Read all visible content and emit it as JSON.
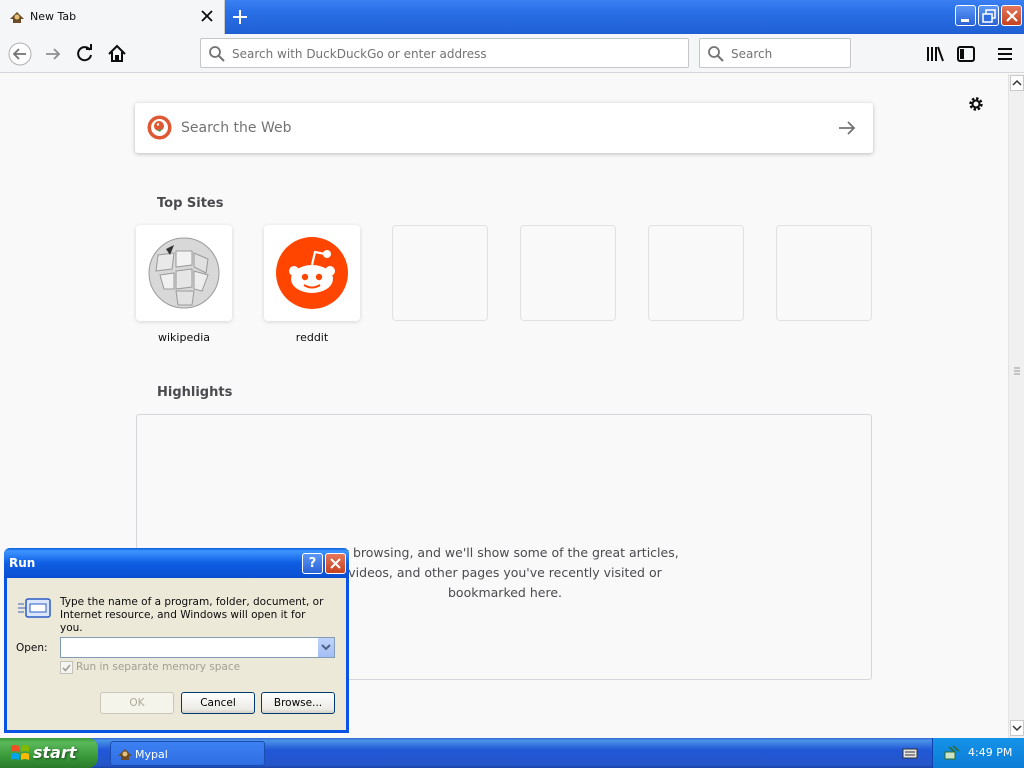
{
  "tab": {
    "title": "New Tab"
  },
  "nav": {
    "url_placeholder": "Search with DuckDuckGo or enter address",
    "search_placeholder": "Search"
  },
  "newtab": {
    "websearch_placeholder": "Search the Web",
    "top_sites_title": "Top Sites",
    "top_sites": [
      {
        "label": "wikipedia"
      },
      {
        "label": "reddit"
      },
      {
        "label": ""
      },
      {
        "label": ""
      },
      {
        "label": ""
      },
      {
        "label": ""
      }
    ],
    "highlights_title": "Highlights",
    "highlights_message_lines": [
      "art browsing, and we'll show some of the great articles,",
      "videos, and other pages you've recently visited or",
      "bookmarked here."
    ]
  },
  "run_dialog": {
    "title": "Run",
    "help_glyph": "?",
    "description": "Type the name of a program, folder, document, or Internet resource, and Windows will open it for you.",
    "open_label": "Open:",
    "open_value": "",
    "checkbox_label": "Run in separate memory space",
    "ok_label": "OK",
    "cancel_label": "Cancel",
    "browse_label": "Browse..."
  },
  "taskbar": {
    "start_label": "start",
    "task_label": "Mypal",
    "clock": "4:49 PM"
  },
  "colors": {
    "xp_blue": "#2456c9",
    "start_green": "#3a9a3a",
    "reddit_orange": "#ff4500",
    "ddg_orange": "#de5833"
  }
}
